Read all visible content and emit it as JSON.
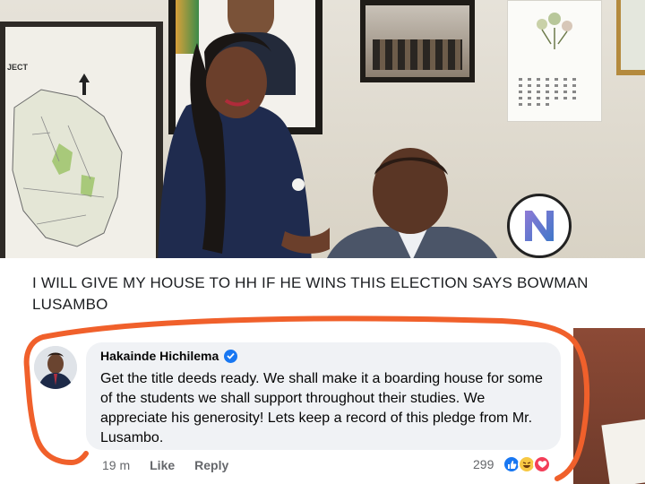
{
  "post": {
    "headline": "I WILL GIVE MY HOUSE TO HH IF HE WINS THIS ELECTION SAYS BOWMAN LUSAMBO"
  },
  "background_photo": {
    "map_title": "JECT"
  },
  "comment": {
    "author": "Hakainde Hichilema",
    "verified": true,
    "text": "Get the title deeds ready. We shall make it a boarding house for some of the students we shall support throughout their studies. We appreciate his generosity! Lets keep a record of this pledge from Mr. Lusambo.",
    "time": "19 m",
    "like_label": "Like",
    "reply_label": "Reply",
    "reaction_count": "299",
    "reactions": [
      "like-icon",
      "haha-icon",
      "love-icon"
    ]
  },
  "colors": {
    "annotation_stroke": "#f0602b",
    "facebook_blue": "#1877f2",
    "bubble_bg": "#f0f2f5"
  }
}
